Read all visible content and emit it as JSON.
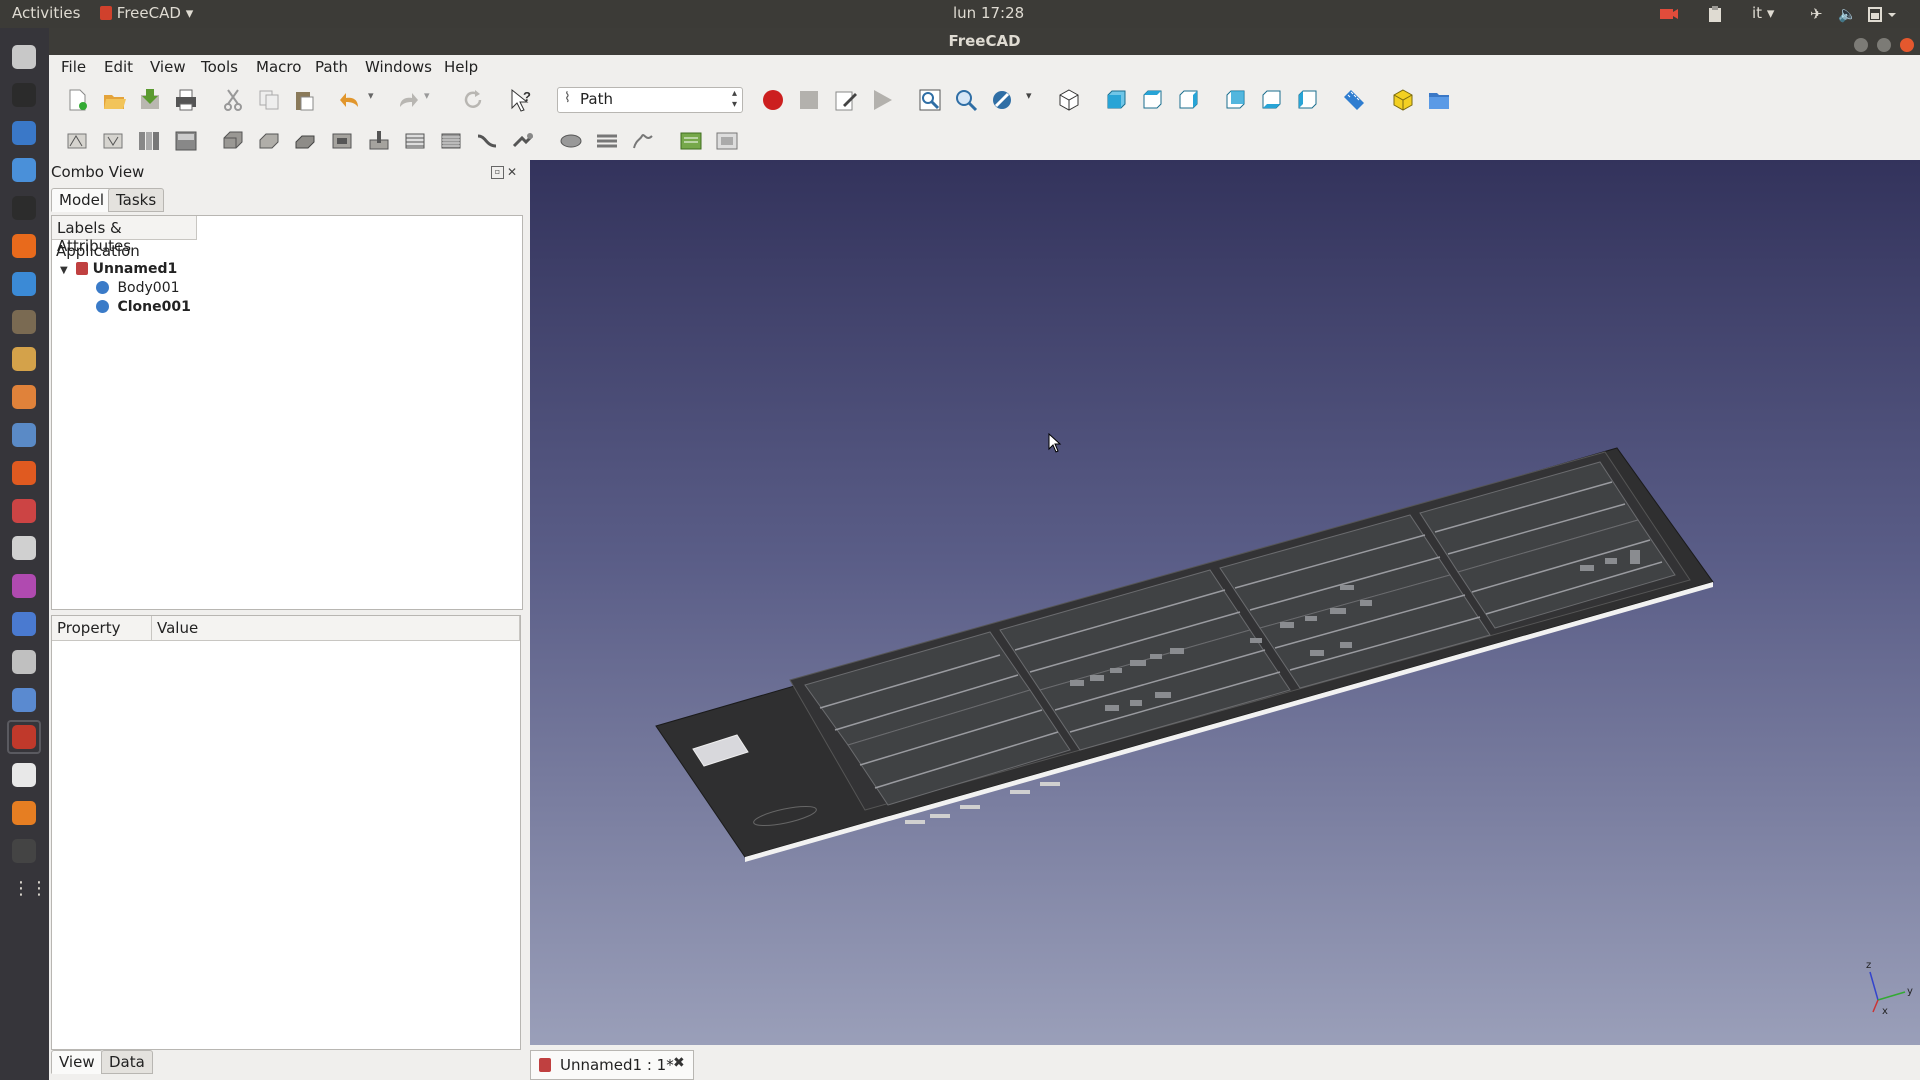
{
  "topbar": {
    "activities": "Activities",
    "app_menu": "FreeCAD",
    "clock": "lun 17:28",
    "keyboard_layout": "it"
  },
  "window": {
    "title": "FreeCAD"
  },
  "menubar": {
    "items": [
      "File",
      "Edit",
      "View",
      "Tools",
      "Macro",
      "Path",
      "Windows",
      "Help"
    ]
  },
  "toolbar": {
    "workbench_selected": "Path"
  },
  "combo_view": {
    "title": "Combo View",
    "tabs": [
      "Model",
      "Tasks"
    ],
    "active_tab": "Model",
    "tree_header": "Labels & Attributes",
    "tree": {
      "root": "Application",
      "document": "Unnamed1",
      "children": [
        "Body001",
        "Clone001"
      ]
    },
    "property_columns": [
      "Property",
      "Value"
    ],
    "bottom_tabs": [
      "View",
      "Data"
    ]
  },
  "document_tab": {
    "label": "Unnamed1 : 1*"
  },
  "axis_labels": [
    "z",
    "x",
    "y"
  ],
  "colors": {
    "accent_close": "#e5582e",
    "viewport_top": "#33335c",
    "viewport_bottom": "#9a9fb9",
    "model_dark": "#2f2f30"
  },
  "icons": {
    "launcher": [
      "files-icon",
      "inkscape-icon",
      "writer-icon",
      "chromium-icon",
      "terminal-icon",
      "firefox-icon",
      "browser-icon",
      "gimp-icon",
      "drawing-icon",
      "blender-icon",
      "settings-icon",
      "software-center-icon",
      "tools-icon",
      "camera-icon",
      "media-icon",
      "network-icon",
      "eye-icon",
      "box-icon",
      "freecad-icon",
      "editor-icon",
      "vlc-icon",
      "video-editor-icon",
      "apps-grid-icon"
    ]
  }
}
